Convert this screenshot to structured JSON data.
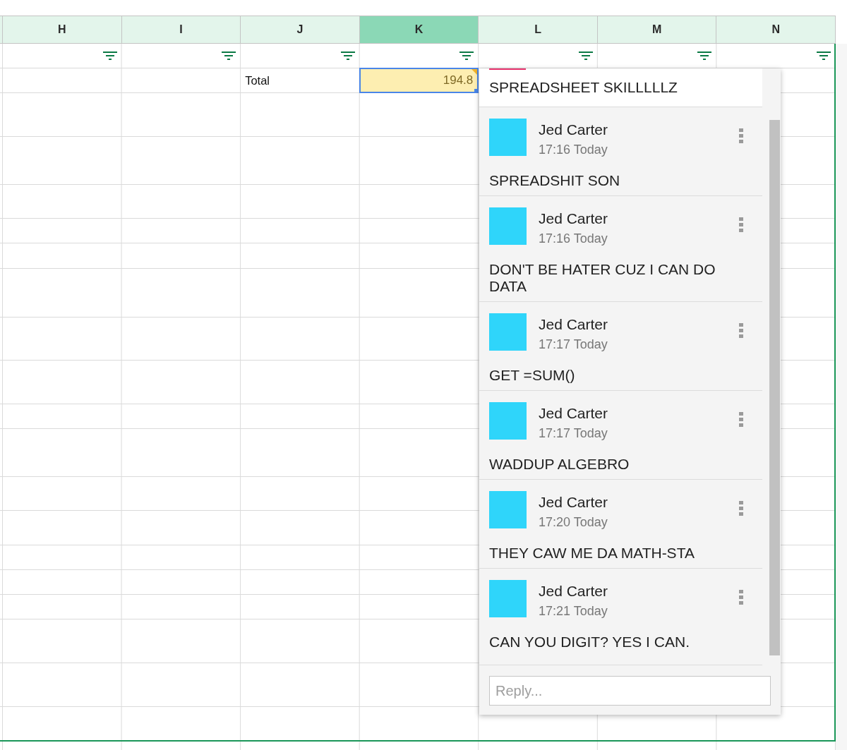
{
  "columns": [
    {
      "label": "H",
      "selected": false
    },
    {
      "label": "I",
      "selected": false
    },
    {
      "label": "J",
      "selected": false
    },
    {
      "label": "K",
      "selected": true
    },
    {
      "label": "L",
      "selected": false
    },
    {
      "label": "M",
      "selected": false
    },
    {
      "label": "N",
      "selected": false
    }
  ],
  "total_row": {
    "label": "Total",
    "value": "194.8",
    "value_selected": true,
    "value_highlighted": true,
    "has_comment": true
  },
  "comment_panel": {
    "thread_text": "SPREADSHEET SKILLLLLZ",
    "comments": [
      {
        "author": "Jed Carter",
        "time": "17:16 Today",
        "text": "SPREADSHIT SON"
      },
      {
        "author": "Jed Carter",
        "time": "17:16 Today",
        "text": "DON'T BE HATER CUZ I CAN DO DATA"
      },
      {
        "author": "Jed Carter",
        "time": "17:17 Today",
        "text": "GET =SUM()"
      },
      {
        "author": "Jed Carter",
        "time": "17:17 Today",
        "text": "WADDUP ALGEBRO"
      },
      {
        "author": "Jed Carter",
        "time": "17:20 Today",
        "text": "THEY CAW ME DA MATH-STA"
      },
      {
        "author": "Jed Carter",
        "time": "17:21 Today",
        "text": "CAN YOU DIGIT? YES I CAN."
      }
    ],
    "reply": {
      "placeholder": "Reply..."
    }
  }
}
